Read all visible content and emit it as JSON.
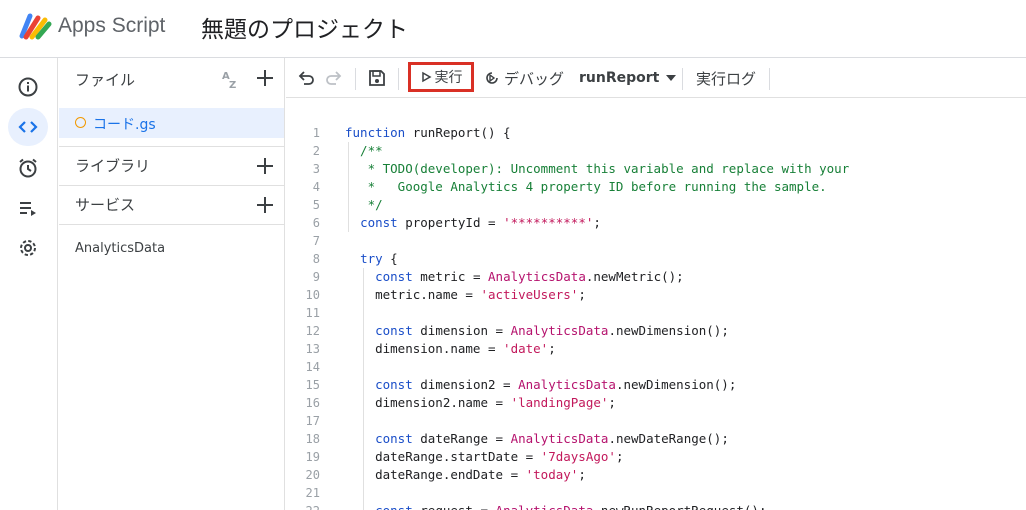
{
  "header": {
    "app_name": "Apps Script",
    "project_title": "無題のプロジェクト"
  },
  "rail": {
    "items": [
      {
        "name": "overview",
        "icon": "info-icon"
      },
      {
        "name": "editor",
        "icon": "code-icon",
        "active": true
      },
      {
        "name": "triggers",
        "icon": "alarm-icon"
      },
      {
        "name": "executions",
        "icon": "executions-list-icon"
      },
      {
        "name": "settings",
        "icon": "gear-icon"
      }
    ]
  },
  "sidebar": {
    "files_label": "ファイル",
    "file_name": "コード.gs",
    "libraries_label": "ライブラリ",
    "services_label": "サービス",
    "service_item": "AnalyticsData"
  },
  "toolbar": {
    "run_label": "実行",
    "debug_label": "デバッグ",
    "function_select": "runReport",
    "log_label": "実行ログ"
  },
  "code": {
    "lines": [
      {
        "n": "1",
        "text": "function runReport() {"
      },
      {
        "n": "2",
        "text": "  /**"
      },
      {
        "n": "3",
        "text": "   * TODO(developer): Uncomment this variable and replace with your"
      },
      {
        "n": "4",
        "text": "   *   Google Analytics 4 property ID before running the sample."
      },
      {
        "n": "5",
        "text": "   */"
      },
      {
        "n": "6",
        "text": "  const propertyId = '**********';"
      },
      {
        "n": "7",
        "text": ""
      },
      {
        "n": "8",
        "text": "  try {"
      },
      {
        "n": "9",
        "text": "    const metric = AnalyticsData.newMetric();"
      },
      {
        "n": "10",
        "text": "    metric.name = 'activeUsers';"
      },
      {
        "n": "11",
        "text": ""
      },
      {
        "n": "12",
        "text": "    const dimension = AnalyticsData.newDimension();"
      },
      {
        "n": "13",
        "text": "    dimension.name = 'date';"
      },
      {
        "n": "14",
        "text": ""
      },
      {
        "n": "15",
        "text": "    const dimension2 = AnalyticsData.newDimension();"
      },
      {
        "n": "16",
        "text": "    dimension2.name = 'landingPage';"
      },
      {
        "n": "17",
        "text": ""
      },
      {
        "n": "18",
        "text": "    const dateRange = AnalyticsData.newDateRange();"
      },
      {
        "n": "19",
        "text": "    dateRange.startDate = '7daysAgo';"
      },
      {
        "n": "20",
        "text": "    dateRange.endDate = 'today';"
      },
      {
        "n": "21",
        "text": ""
      },
      {
        "n": "22",
        "text": "    const request = AnalyticsData.newRunReportRequest();"
      }
    ]
  },
  "colors": {
    "accent": "#1a73e8",
    "highlight_border": "#d93025",
    "keyword": "#1a4ec8",
    "string": "#c2185b",
    "comment": "#188038"
  }
}
